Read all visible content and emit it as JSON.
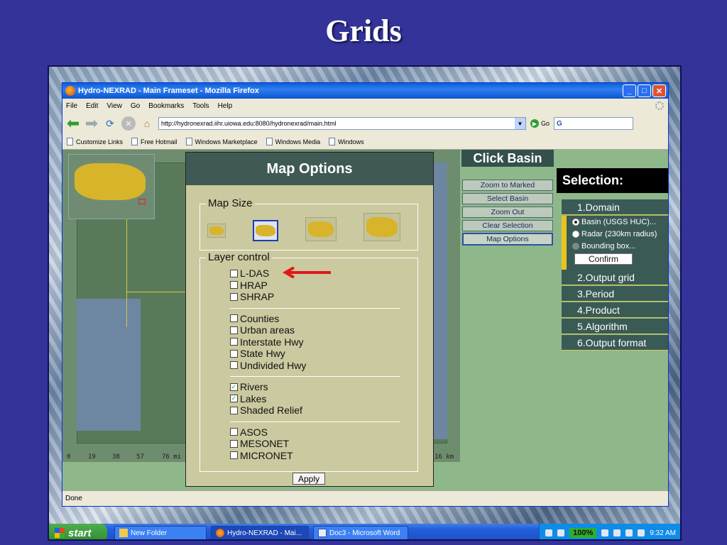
{
  "slide": {
    "title": "Grids"
  },
  "browser": {
    "window_title": "Hydro-NEXRAD - Main Frameset - Mozilla Firefox",
    "menu": [
      "File",
      "Edit",
      "View",
      "Go",
      "Bookmarks",
      "Tools",
      "Help"
    ],
    "url": "http://hydronexrad.iihr.uiowa.edu:8080/hydronexrad/main.html",
    "go_label": "Go",
    "search_value": "G",
    "bookmarks": [
      "Customize Links",
      "Free Hotmail",
      "Windows Marketplace",
      "Windows Media",
      "Windows"
    ],
    "status": "Done"
  },
  "map": {
    "scale_labels": [
      "0",
      "19",
      "38",
      "57",
      "76 mi"
    ],
    "scale_right": "16 km"
  },
  "map_options": {
    "title": "Map Options",
    "map_size_legend": "Map Size",
    "layer_control_legend": "Layer control",
    "groups": [
      [
        {
          "label": "L-DAS",
          "checked": false
        },
        {
          "label": "HRAP",
          "checked": false
        },
        {
          "label": "SHRAP",
          "checked": false
        }
      ],
      [
        {
          "label": "Counties",
          "checked": false
        },
        {
          "label": "Urban areas",
          "checked": false
        },
        {
          "label": "Interstate Hwy",
          "checked": false
        },
        {
          "label": "State Hwy",
          "checked": false
        },
        {
          "label": "Undivided Hwy",
          "checked": false
        }
      ],
      [
        {
          "label": "Rivers",
          "checked": true
        },
        {
          "label": "Lakes",
          "checked": true
        },
        {
          "label": "Shaded Relief",
          "checked": false
        }
      ],
      [
        {
          "label": "ASOS",
          "checked": false
        },
        {
          "label": "MESONET",
          "checked": false
        },
        {
          "label": "MICRONET",
          "checked": false
        }
      ]
    ],
    "apply_label": "Apply"
  },
  "click_basin": {
    "title": "Click Basin",
    "buttons": [
      "Zoom to Marked",
      "Select Basin",
      "Zoom Out",
      "Clear Selection",
      "Map Options"
    ]
  },
  "selection": {
    "title": "Selection:",
    "domain_label": "1.Domain",
    "domain_options": [
      "Basin (USGS HUC)...",
      "Radar (230km radius)",
      "Bounding box..."
    ],
    "confirm_label": "Confirm",
    "steps": [
      "2.Output grid",
      "3.Period",
      "4.Product",
      "5.Algorithm",
      "6.Output format"
    ]
  },
  "taskbar": {
    "start_label": "start",
    "tasks": [
      "New Folder",
      "Hydro-NEXRAD - Mai...",
      "Doc3 - Microsoft Word"
    ],
    "zoom": "100%",
    "clock": "9:32 AM"
  },
  "colors": {
    "slide_bg": "#33339a",
    "dialog_bg": "#cbc99f",
    "dialog_header": "#3f5a55",
    "accent_yellow": "#e6c420",
    "arrow_red": "#e01818"
  }
}
